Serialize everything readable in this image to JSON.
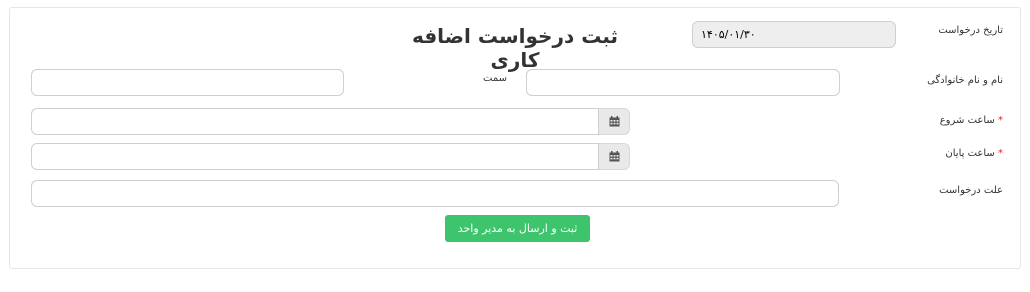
{
  "form": {
    "title": "ثبت درخواست اضافه کاری",
    "request_date_label": "تاریخ درخواست",
    "request_date_value": "۱۴۰۵/۰۱/۳۰",
    "full_name_label": "نام و نام خانوادگی",
    "full_name_value": "",
    "position_label": "سمت",
    "position_value": "",
    "start_time_label": "ساعت شروع",
    "start_time_value": "",
    "end_time_label": "ساعت پایان",
    "end_time_value": "",
    "required_mark": "*",
    "reason_label": "علت درخواست",
    "reason_value": "",
    "submit_label": "ثبت و ارسال به مدیر واحد"
  },
  "icons": {
    "start_time_picker": "calendar-icon",
    "end_time_picker": "calendar-icon"
  },
  "colors": {
    "submit_button": "#3ec46d",
    "required_mark": "#e02424",
    "readonly_field": "#eeeeee"
  }
}
